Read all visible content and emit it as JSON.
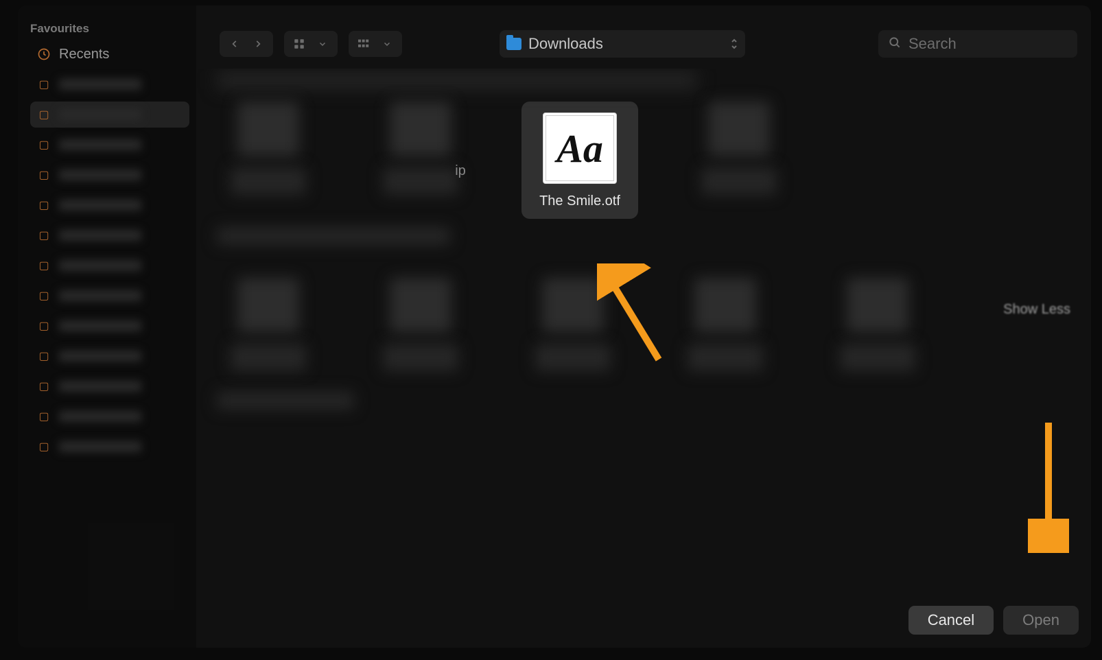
{
  "sidebar": {
    "section_title": "Favourites",
    "recents_label": "Recents"
  },
  "toolbar": {
    "location_label": "Downloads",
    "search_placeholder": "Search"
  },
  "file": {
    "selected_name": "The Smile.otf",
    "font_glyphs": "Aa",
    "zip_suffix": "ip"
  },
  "content": {
    "show_less_label": "Show Less"
  },
  "footer": {
    "cancel_label": "Cancel",
    "open_label": "Open"
  },
  "colors": {
    "annotation": "#f59b1c"
  }
}
